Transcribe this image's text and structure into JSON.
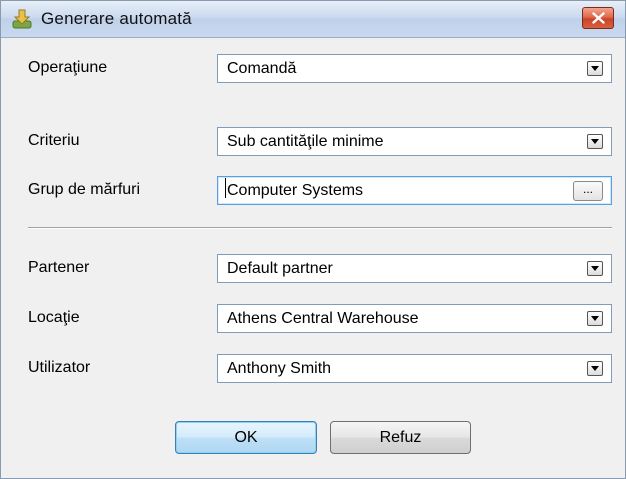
{
  "window": {
    "title": "Generare automată",
    "icon": "download-arrow-icon",
    "close_icon": "close-icon"
  },
  "form": {
    "operation": {
      "label": "Operaţiune",
      "value": "Comandă"
    },
    "criterion": {
      "label": "Criteriu",
      "value": "Sub cantităţile minime"
    },
    "item_group": {
      "label": "Grup de mărfuri",
      "value": "Computer Systems",
      "button_label": "..."
    },
    "partner": {
      "label": "Partener",
      "value": "Default partner"
    },
    "location": {
      "label": "Locaţie",
      "value": "Athens Central Warehouse"
    },
    "user": {
      "label": "Utilizator",
      "value": "Anthony Smith"
    }
  },
  "buttons": {
    "ok": "OK",
    "cancel": "Refuz"
  },
  "colors": {
    "close_button": "#d9603f",
    "ok_button_border": "#3c7fb1",
    "dialog_background": "#f0f0f0"
  }
}
